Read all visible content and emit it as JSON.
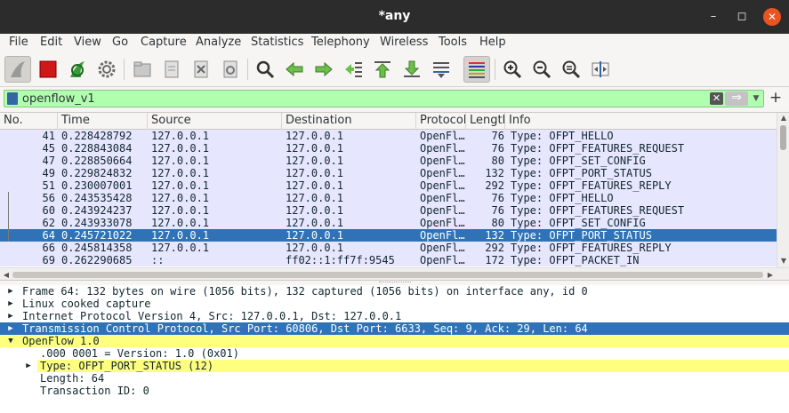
{
  "window": {
    "title": "*any",
    "min": "–",
    "max": "◻",
    "close": "✕"
  },
  "menu": [
    "File",
    "Edit",
    "View",
    "Go",
    "Capture",
    "Analyze",
    "Statistics",
    "Telephony",
    "Wireless",
    "Tools",
    "Help"
  ],
  "filter": {
    "value": "openflow_v1",
    "clear": "✕",
    "apply": "⇒",
    "dropdown": "▼",
    "add": "+"
  },
  "columns": [
    "No.",
    "Time",
    "Source",
    "Destination",
    "Protocol",
    "Length",
    "Info"
  ],
  "packets": [
    {
      "no": "41",
      "time": "0.228428792",
      "src": "127.0.0.1",
      "dst": "127.0.0.1",
      "proto": "OpenFl…",
      "len": "76",
      "info": "Type: OFPT_HELLO"
    },
    {
      "no": "45",
      "time": "0.228843084",
      "src": "127.0.0.1",
      "dst": "127.0.0.1",
      "proto": "OpenFl…",
      "len": "76",
      "info": "Type: OFPT_FEATURES_REQUEST"
    },
    {
      "no": "47",
      "time": "0.228850664",
      "src": "127.0.0.1",
      "dst": "127.0.0.1",
      "proto": "OpenFl…",
      "len": "80",
      "info": "Type: OFPT_SET_CONFIG"
    },
    {
      "no": "49",
      "time": "0.229824832",
      "src": "127.0.0.1",
      "dst": "127.0.0.1",
      "proto": "OpenFl…",
      "len": "132",
      "info": "Type: OFPT_PORT_STATUS"
    },
    {
      "no": "51",
      "time": "0.230007001",
      "src": "127.0.0.1",
      "dst": "127.0.0.1",
      "proto": "OpenFl…",
      "len": "292",
      "info": "Type: OFPT_FEATURES_REPLY"
    },
    {
      "no": "56",
      "time": "0.243535428",
      "src": "127.0.0.1",
      "dst": "127.0.0.1",
      "proto": "OpenFl…",
      "len": "76",
      "info": "Type: OFPT_HELLO"
    },
    {
      "no": "60",
      "time": "0.243924237",
      "src": "127.0.0.1",
      "dst": "127.0.0.1",
      "proto": "OpenFl…",
      "len": "76",
      "info": "Type: OFPT_FEATURES_REQUEST"
    },
    {
      "no": "62",
      "time": "0.243933078",
      "src": "127.0.0.1",
      "dst": "127.0.0.1",
      "proto": "OpenFl…",
      "len": "80",
      "info": "Type: OFPT_SET_CONFIG"
    },
    {
      "no": "64",
      "time": "0.245721022",
      "src": "127.0.0.1",
      "dst": "127.0.0.1",
      "proto": "OpenFl…",
      "len": "132",
      "info": "Type: OFPT_PORT_STATUS"
    },
    {
      "no": "66",
      "time": "0.245814358",
      "src": "127.0.0.1",
      "dst": "127.0.0.1",
      "proto": "OpenFl…",
      "len": "292",
      "info": "Type: OFPT_FEATURES_REPLY"
    },
    {
      "no": "69",
      "time": "0.262290685",
      "src": "::",
      "dst": "ff02::1:ff7f:9545",
      "proto": "OpenFl…",
      "len": "172",
      "info": "Type: OFPT_PACKET_IN"
    }
  ],
  "selected_packet": "64",
  "details": [
    {
      "text": "Frame 64: 132 bytes on wire (1056 bits), 132 captured (1056 bits) on interface any, id 0",
      "twist": "▶",
      "hl": ""
    },
    {
      "text": "Linux cooked capture",
      "twist": "▶",
      "hl": ""
    },
    {
      "text": "Internet Protocol Version 4, Src: 127.0.0.1, Dst: 127.0.0.1",
      "twist": "▶",
      "hl": ""
    },
    {
      "text": "Transmission Control Protocol, Src Port: 60806, Dst Port: 6633, Seq: 9, Ack: 29, Len: 64",
      "twist": "▶",
      "hl": "blue"
    },
    {
      "text": "OpenFlow 1.0",
      "twist": "▼",
      "hl": "yellow"
    },
    {
      "text": ".000 0001 = Version: 1.0 (0x01)",
      "twist": "",
      "hl": "",
      "indent": 1
    },
    {
      "text": "Type: OFPT_PORT_STATUS (12)",
      "twist": "▶",
      "hl": "yellow",
      "indent": 1
    },
    {
      "text": "Length: 64",
      "twist": "",
      "hl": "",
      "indent": 1
    },
    {
      "text": "Transaction ID: 0",
      "twist": "",
      "hl": "",
      "indent": 1
    }
  ],
  "colors": {
    "row_bg": "#e7e6ff",
    "selected": "#2f73b6",
    "filter_ok": "#afffaf",
    "highlight": "#ffff7f"
  }
}
